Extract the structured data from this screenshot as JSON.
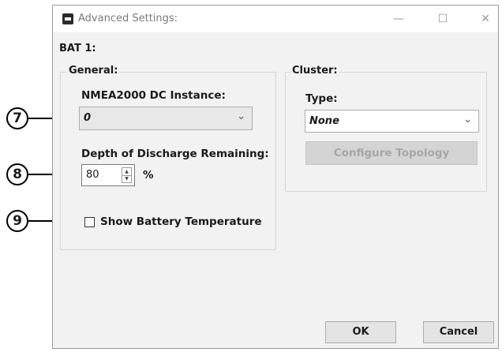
{
  "window": {
    "title": "Advanced Settings:",
    "controls": {
      "minimize": "—",
      "maximize": "☐",
      "close": "✕"
    }
  },
  "section_title": "BAT 1:",
  "general": {
    "legend": "General:",
    "dc_instance_label": "NMEA2000 DC Instance:",
    "dc_instance_value": "0",
    "dod_label": "Depth of Discharge Remaining:",
    "dod_value": "80",
    "dod_unit": "%",
    "show_temp_label": "Show Battery Temperature",
    "show_temp_checked": false
  },
  "cluster": {
    "legend": "Cluster:",
    "type_label": "Type:",
    "type_value": "None",
    "configure_label": "Configure Topology"
  },
  "buttons": {
    "ok": "OK",
    "cancel": "Cancel"
  },
  "callouts": [
    "7",
    "8",
    "9"
  ],
  "icons": {
    "dropdown": "chevron-down-icon",
    "spin_up": "triangle-up-icon",
    "spin_down": "triangle-down-icon"
  }
}
